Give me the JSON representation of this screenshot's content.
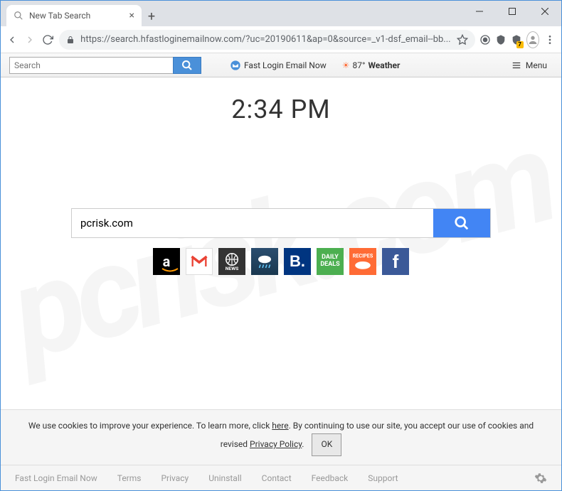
{
  "watermark": "pcrisk.com",
  "browser": {
    "tab_title": "New Tab Search",
    "url": "https://search.hfastloginemailnow.com/?uc=20190611&ap=0&source=_v1-dsf_email--bb...",
    "ext_badge": "7"
  },
  "toolbar": {
    "search_placeholder": "Search",
    "link1": "Fast Login Email Now",
    "weather_temp": "87°",
    "weather_label": "Weather",
    "menu_label": "Menu"
  },
  "page": {
    "clock": "2:34 PM",
    "search_value": "pcrisk.com",
    "tiles": {
      "amazon": "a",
      "deals": "DAILY DEALS",
      "recipes": "RECIPES",
      "fb": "f",
      "booking": "B."
    }
  },
  "cookie": {
    "text1": "We use cookies to improve your experience. To learn more, click ",
    "link1": "here",
    "text2": ". By continuing to use our site, you accept our use of cookies and revised ",
    "link2": "Privacy Policy",
    "text3": ".",
    "ok": "OK"
  },
  "footer": {
    "brand": "Fast Login Email Now",
    "terms": "Terms",
    "privacy": "Privacy",
    "uninstall": "Uninstall",
    "contact": "Contact",
    "feedback": "Feedback",
    "support": "Support"
  }
}
